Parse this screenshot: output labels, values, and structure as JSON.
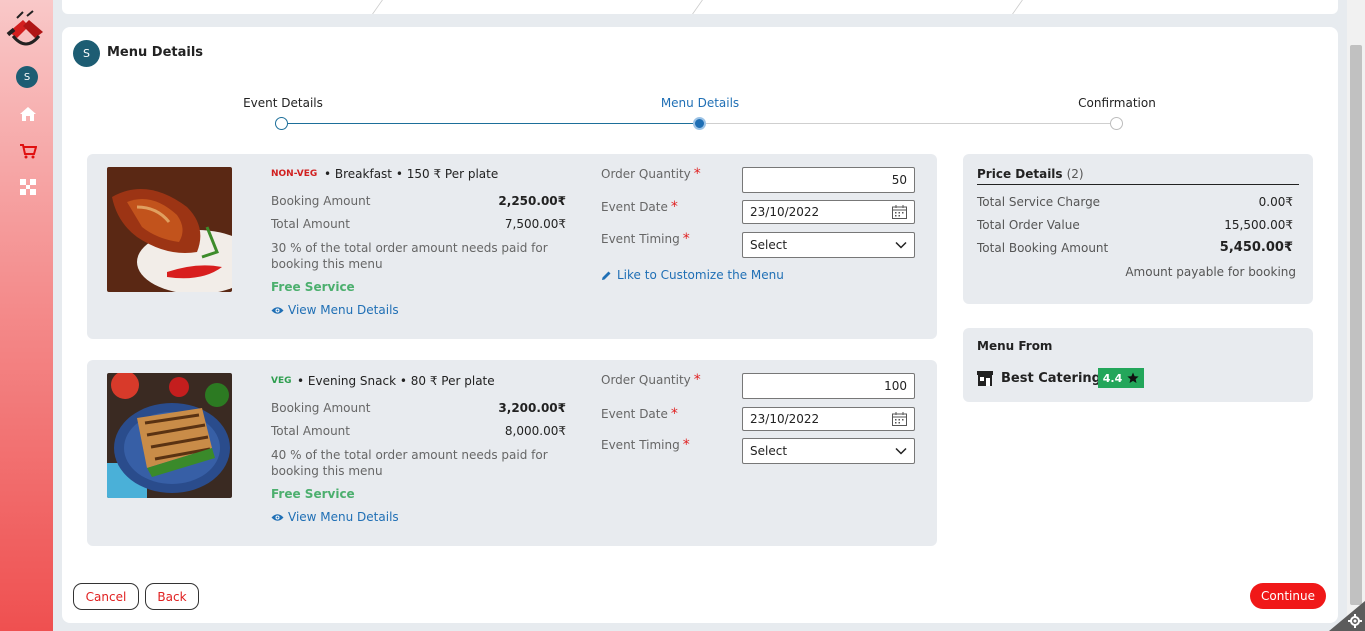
{
  "sidebar": {
    "avatar_letter": "S",
    "items": [
      {
        "icon": "home-icon"
      },
      {
        "icon": "cart-icon"
      },
      {
        "icon": "grid-icon"
      }
    ]
  },
  "header": {
    "avatar_letter": "S",
    "title": "Menu Details"
  },
  "stepper": {
    "steps": [
      {
        "label": "Event Details",
        "state": "done"
      },
      {
        "label": "Menu Details",
        "state": "active"
      },
      {
        "label": "Confirmation",
        "state": "pending"
      }
    ]
  },
  "menu_items": [
    {
      "tag": "NON-VEG",
      "tag_color": "#d12020",
      "headline": "• Breakfast • 150 ₹ Per plate",
      "booking_amount_label": "Booking Amount",
      "booking_amount": "2,250.00₹",
      "total_amount_label": "Total Amount",
      "total_amount": "7,500.00₹",
      "note": "30 % of the total order amount needs paid for booking this menu",
      "free_service": "Free Service",
      "view_link": "View Menu Details",
      "order_quantity_label": "Order Quantity",
      "order_quantity": "50",
      "event_date_label": "Event Date",
      "event_date": "23/10/2022",
      "event_timing_label": "Event Timing",
      "event_timing": "Select",
      "customize_link": "Like to Customize the Menu"
    },
    {
      "tag": "VEG",
      "tag_color": "#2e9e4f",
      "headline": "• Evening Snack • 80 ₹ Per plate",
      "booking_amount_label": "Booking Amount",
      "booking_amount": "3,200.00₹",
      "total_amount_label": "Total Amount",
      "total_amount": "8,000.00₹",
      "note": "40 % of the total order amount needs paid for booking this menu",
      "free_service": "Free Service",
      "view_link": "View Menu Details",
      "order_quantity_label": "Order Quantity",
      "order_quantity": "100",
      "event_date_label": "Event Date",
      "event_date": "23/10/2022",
      "event_timing_label": "Event Timing",
      "event_timing": "Select"
    }
  ],
  "price_details": {
    "title": "Price Details",
    "count": "(2)",
    "rows": [
      {
        "label": "Total Service Charge",
        "value": "0.00₹"
      },
      {
        "label": "Total Order Value",
        "value": "15,500.00₹"
      },
      {
        "label": "Total Booking Amount",
        "value": "5,450.00₹"
      }
    ],
    "note": "Amount payable for booking"
  },
  "menu_from": {
    "title": "Menu From",
    "caterer": "Best Catering",
    "rating": "4.4"
  },
  "buttons": {
    "cancel": "Cancel",
    "back": "Back",
    "continue": "Continue"
  },
  "colors": {
    "accent_blue": "#1f6fb5",
    "avatar": "#1d5d73",
    "primary_red": "#f01818",
    "rating_green": "#23a65a"
  }
}
